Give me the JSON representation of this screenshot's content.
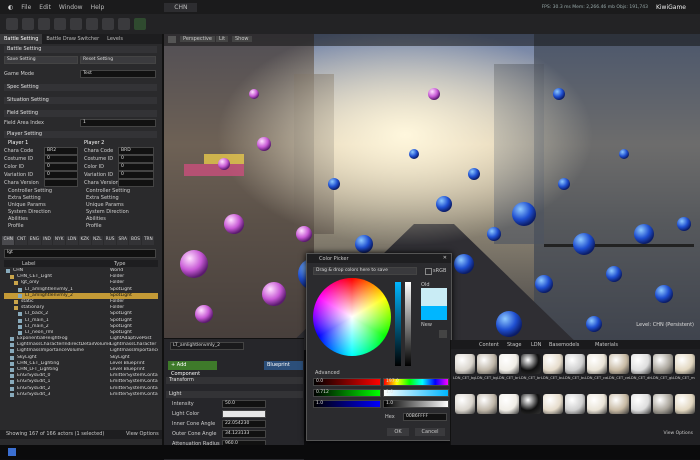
{
  "window": {
    "title": "KiwiGame",
    "tab": "CHN",
    "fps": "FPS: 30.3 ms Mem: 2,266.46 mb Objs: 191,743"
  },
  "menu": [
    "File",
    "Edit",
    "Window",
    "Help"
  ],
  "left_panel": {
    "tabs": [
      "Battle Setting",
      "Battle Draw Switcher",
      "Levels"
    ],
    "battle_setting_header": "Battle Setting",
    "save_setting": "Save Setting",
    "reset_setting": "Reset Setting",
    "game_mode_label": "Game Mode",
    "game_mode_value": "Test",
    "spec_setting": "Spec Setting",
    "situation_setting": "Situation Setting",
    "field_setting": "Field Setting",
    "field_area_index": "Field Area Index",
    "field_area_value": "1",
    "player_setting": "Player Setting",
    "player1": {
      "title": "Player 1",
      "fields": [
        "Chara Code",
        "Costume ID",
        "Color ID",
        "Variation ID",
        "Chara Version"
      ],
      "values": [
        "BR2",
        "0",
        "0",
        "0",
        ""
      ],
      "subsections": [
        "Controller Setting",
        "Extra Setting",
        "Unique Params",
        "System Direction",
        "Abilities",
        "Profile"
      ]
    },
    "player2": {
      "title": "Player 2",
      "fields": [
        "Chara Code",
        "Costume ID",
        "Color ID",
        "Variation ID",
        "Chara Version"
      ],
      "values": [
        "BRD",
        "0",
        "0",
        "0",
        ""
      ],
      "subsections": [
        "Controller Setting",
        "Extra Setting",
        "Unique Params",
        "System Direction",
        "Abilities",
        "Profile"
      ]
    },
    "level_tabs": [
      "CHN",
      "CNT",
      "ENG",
      "IND",
      "NYK",
      "LDN",
      "KZK",
      "NZL",
      "RUS",
      "SRA",
      "BOS",
      "TRN"
    ],
    "search_value": "lgt",
    "outliner_headers": [
      "Label",
      "Type"
    ],
    "outliner_rows": [
      {
        "label": "CHN",
        "type": "World"
      },
      {
        "label": "CHN_CET_Light",
        "type": "Folder"
      },
      {
        "label": "lgt_only",
        "type": "Folder"
      },
      {
        "label": "LT_amlightlenvmly_1",
        "type": "SpotLight"
      },
      {
        "label": "LT_amlightlenvmly_2",
        "type": "SpotLight"
      },
      {
        "label": "static",
        "type": "Folder"
      },
      {
        "label": "stationary",
        "type": "Folder"
      },
      {
        "label": "LT_back_2",
        "type": "SpotLight"
      },
      {
        "label": "LT_main_1",
        "type": "SpotLight"
      },
      {
        "label": "LT_main_2",
        "type": "SpotLight"
      },
      {
        "label": "LT_neon_rml",
        "type": "SpotLight"
      },
      {
        "label": "ExponentialHeightFog",
        "type": "LightAdaptivePost"
      },
      {
        "label": "LightmassCharacterIndirectDetailVolume",
        "type": "LightmassCharacter"
      },
      {
        "label": "LightmassImportanceVolume",
        "type": "LightmassImportance"
      },
      {
        "label": "SkyLight",
        "type": "SkyLight"
      },
      {
        "label": "CHN_CET_Lighting",
        "type": "Level Blueprint"
      },
      {
        "label": "CHN_LFT_Lighting",
        "type": "Level Blueprint"
      },
      {
        "label": "EnGrSysEdit_0",
        "type": "EmitterSystemContainer"
      },
      {
        "label": "EnGrSysEdit_1",
        "type": "EmitterSystemContainer"
      },
      {
        "label": "EnGrSysEdit_2",
        "type": "EmitterSystemContainer"
      },
      {
        "label": "EnGrSysEdit_3",
        "type": "EmitterSystemContainer"
      }
    ],
    "status": "Showing 167 of 166 actors (1 selected)",
    "view_options": "View Options"
  },
  "viewport": {
    "perspective": "Perspective",
    "lit": "Lit",
    "show": "Show",
    "level_label": "Level: CHN (Persistent)"
  },
  "details": {
    "object_name": "LT_amlightlenvmly_2",
    "add_component": "+ Add Component",
    "blueprint": "Blueprint",
    "transform": "Transform",
    "light": "Light",
    "props": [
      "Intensity",
      "Light Color",
      "Inner Cone Angle",
      "Outer Cone Angle",
      "Attenuation Radius"
    ],
    "values": [
      "50.0",
      "",
      "22.054230",
      "34.123133",
      "960.0"
    ]
  },
  "color_picker": {
    "title": "Color Picker",
    "drop_hint": "Drag & drop colors here to save",
    "srgb": "sRGB",
    "old": "Old",
    "new": "New",
    "advanced": "Advanced",
    "left_values": [
      "0.0",
      "0.712",
      "1.0"
    ],
    "right_values": [
      "197.0",
      "1.0",
      "1.0"
    ],
    "hex_label": "Hex",
    "hex_value": "00B6FFFF",
    "ok": "OK",
    "cancel": "Cancel"
  },
  "content_browser": {
    "path": [
      "Content",
      "Stage",
      "LDN",
      "Basemodels",
      "Materials"
    ],
    "items": 22,
    "labels": [
      "LDN_CET_bg005_01",
      "LDN_CET_bg005_02",
      "LDN_CET_bridge",
      "LDN_CET_brick",
      "LDN_CET_building_01",
      "LDN_CET_building_02",
      "LDN_CET_car",
      "LDN_CET_ceiling",
      "LDN_CET_dish",
      "LDN_CET_glass",
      "LDN_CET_metal"
    ],
    "view_options": "View Options"
  },
  "colors": {
    "accent": "#c49a36",
    "green": "#4c6b2b",
    "picker_new": "#00b6ff"
  }
}
